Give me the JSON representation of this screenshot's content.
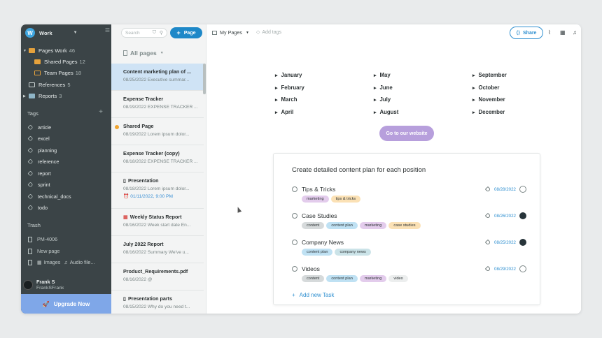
{
  "workspace": {
    "initial": "W",
    "name": "Work"
  },
  "tree": [
    {
      "label": "Pages Work",
      "count": "46"
    },
    {
      "label": "Shared Pages",
      "count": "12"
    },
    {
      "label": "Team Pages",
      "count": "18"
    },
    {
      "label": "References",
      "count": "5"
    },
    {
      "label": "Reports",
      "count": "3"
    }
  ],
  "tags_header": "Tags",
  "tags": [
    "article",
    "excel",
    "planning",
    "reference",
    "report",
    "sprint",
    "technical_docs",
    "todo"
  ],
  "trash_header": "Trash",
  "trash": [
    "PM-4006",
    "New page",
    "Images",
    "Audio file..."
  ],
  "user": {
    "name": "Frank S",
    "handle": "FrankSFrank"
  },
  "upgrade_label": "Upgrade Now",
  "list": {
    "search_placeholder": "Search",
    "page_button": "Page",
    "filter_label": "All pages",
    "items": [
      {
        "title": "Content marketing plan of ...",
        "sub": "08/25/2022 Executive summar..."
      },
      {
        "title": "Expense Tracker",
        "sub": "08/19/2022 EXPENSE TRACKER ..."
      },
      {
        "title": "Shared Page",
        "sub": "08/19/2022 Lorem ipsum dolor..."
      },
      {
        "title": "Expense Tracker (copy)",
        "sub": "08/18/2022 EXPENSE TRACKER ..."
      },
      {
        "title": "Presentation",
        "sub": "08/18/2022 Lorem ipsum dolor...",
        "extra": "01/11/2022, 9:00 PM"
      },
      {
        "title": "Weekly Status Report",
        "sub": "08/16/2022 Week start date En..."
      },
      {
        "title": "July 2022 Report",
        "sub": "08/16/2022 Summary We've u..."
      },
      {
        "title": "Product_Requirements.pdf",
        "sub": "08/16/2022 @"
      },
      {
        "title": "Presentation parts",
        "sub": "08/15/2022 Why do you need t..."
      }
    ]
  },
  "topbar": {
    "breadcrumb": "My Pages",
    "add_tags": "Add tags",
    "share_label": "Share"
  },
  "months": [
    [
      "January",
      "February",
      "March",
      "April"
    ],
    [
      "May",
      "June",
      "July",
      "August"
    ],
    [
      "September",
      "October",
      "November",
      "December"
    ]
  ],
  "website_button": "Go to our website",
  "task_card": {
    "title": "Create detailed content plan for each position",
    "tasks": [
      {
        "name": "Tips & Tricks",
        "date": "08/28/2022",
        "assignee": "none",
        "tags": [
          {
            "t": "marketing",
            "c": "#e3ccec"
          },
          {
            "t": "tips & tricks",
            "c": "#fbe1b5"
          }
        ]
      },
      {
        "name": "Case Studies",
        "date": "08/26/2022",
        "assignee": "photo",
        "tags": [
          {
            "t": "content",
            "c": "#d6dadb"
          },
          {
            "t": "content plan",
            "c": "#bfe1f3"
          },
          {
            "t": "marketing",
            "c": "#e3ccec"
          },
          {
            "t": "case studies",
            "c": "#fbe1b5"
          }
        ]
      },
      {
        "name": "Company News",
        "date": "08/25/2022",
        "assignee": "photo",
        "tags": [
          {
            "t": "content plan",
            "c": "#bfe1f3"
          },
          {
            "t": "company news",
            "c": "#cbe3e8"
          }
        ]
      },
      {
        "name": "Videos",
        "date": "08/29/2022",
        "assignee": "none",
        "tags": [
          {
            "t": "content",
            "c": "#d6dadb"
          },
          {
            "t": "content plan",
            "c": "#bfe1f3"
          },
          {
            "t": "marketing",
            "c": "#e3ccec"
          },
          {
            "t": "video",
            "c": "#eceeee"
          }
        ]
      }
    ],
    "add_label": "Add new Task"
  }
}
